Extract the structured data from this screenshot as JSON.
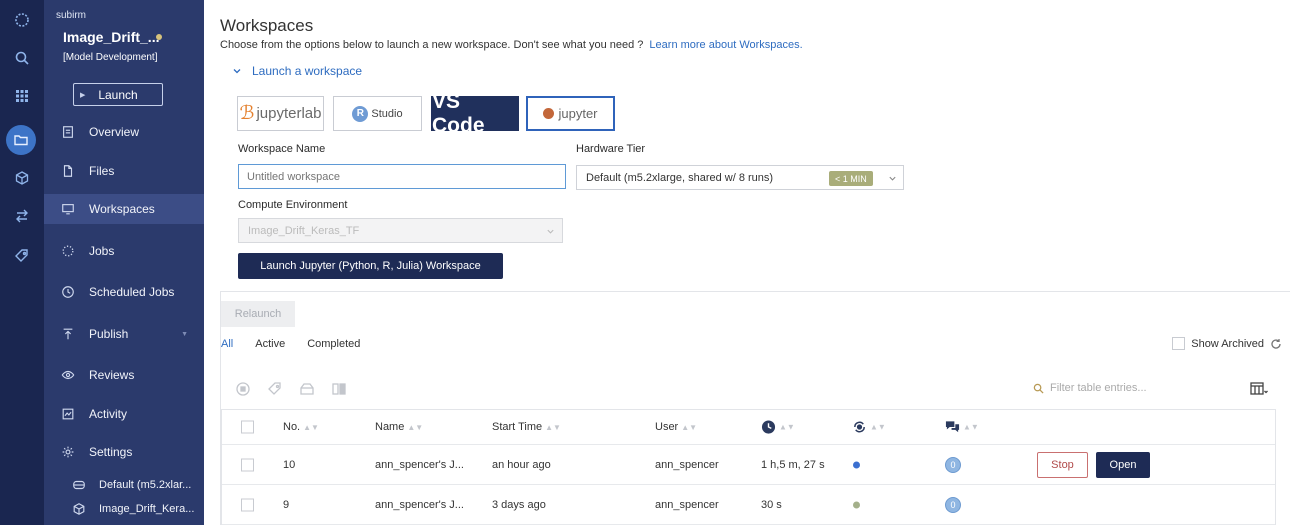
{
  "sidebar": {
    "owner": "subirm",
    "project_name": "Image_Drift_...",
    "project_stage": "[Model Development]",
    "launch_label": "Launch",
    "nav": [
      {
        "label": "Overview",
        "icon": "overview-icon"
      },
      {
        "label": "Files",
        "icon": "file-icon"
      },
      {
        "label": "Workspaces",
        "icon": "monitor-icon"
      },
      {
        "label": "Jobs",
        "icon": "jobs-icon"
      },
      {
        "label": "Scheduled Jobs",
        "icon": "clock-icon"
      },
      {
        "label": "Publish",
        "icon": "publish-icon"
      },
      {
        "label": "Reviews",
        "icon": "eye-icon"
      },
      {
        "label": "Activity",
        "icon": "activity-icon"
      },
      {
        "label": "Settings",
        "icon": "gear-icon"
      }
    ],
    "settings_sub": [
      {
        "label": "Default (m5.2xlar...",
        "icon": "hardware-icon"
      },
      {
        "label": "Image_Drift_Kera...",
        "icon": "cube-icon"
      }
    ]
  },
  "header": {
    "title": "Workspaces",
    "subtitle": "Choose from the options below to launch a new workspace. Don't see what you need ?",
    "learn_more": "Learn more about Workspaces."
  },
  "launch": {
    "section_label": "Launch a workspace",
    "tools": {
      "jupyterlab": "jupyterlab",
      "rstudio": "Studio",
      "rstudio_r": "R",
      "vscode": "VS Code",
      "jupyter": "jupyter"
    },
    "workspace_name_label": "Workspace Name",
    "workspace_name_placeholder": "Untitled workspace",
    "hardware_tier_label": "Hardware Tier",
    "hardware_tier_value": "Default (m5.2xlarge, shared w/ 8 runs)",
    "hardware_tier_badge": "< 1 MIN",
    "compute_env_label": "Compute Environment",
    "compute_env_value": "Image_Drift_Keras_TF",
    "launch_button": "Launch Jupyter (Python, R, Julia) Workspace"
  },
  "runs": {
    "relaunch_label": "Relaunch",
    "tabs": [
      "All",
      "Active",
      "Completed"
    ],
    "show_archived": "Show Archived",
    "filter_placeholder": "Filter table entries...",
    "columns": {
      "no": "No.",
      "name": "Name",
      "start": "Start Time",
      "user": "User"
    },
    "rows": [
      {
        "no": "10",
        "name": "ann_spencer's J...",
        "start": "an hour ago",
        "user": "ann_spencer",
        "duration": "1 h,5 m, 27 s",
        "status_color": "#3b6fd0",
        "comments": "0",
        "stop": "Stop",
        "open": "Open"
      },
      {
        "no": "9",
        "name": "ann_spencer's J...",
        "start": "3 days ago",
        "user": "ann_spencer",
        "duration": "30 s",
        "status_color": "#a4b08a",
        "comments": "0"
      }
    ]
  },
  "colors": {
    "rail": "#1a2650",
    "sidebar": "#2b3a6c",
    "primary": "#1e2b55",
    "link": "#2e6cc0"
  }
}
